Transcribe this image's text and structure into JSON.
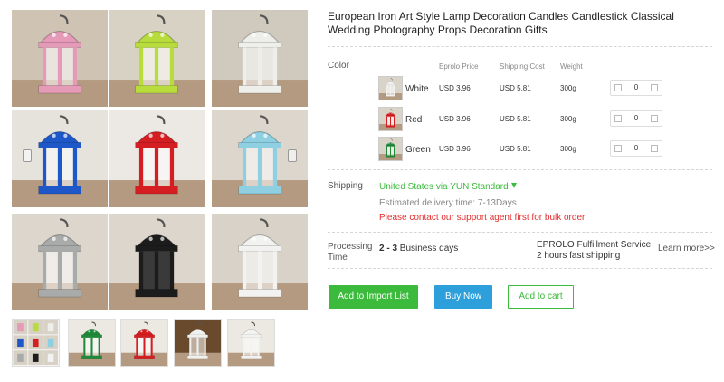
{
  "product": {
    "title": "European Iron Art Style Lamp Decoration Candles Candlestick Classical Wedding Photography Props Decoration Gifts"
  },
  "gallery": {
    "tiles": [
      {
        "name": "pink-lantern",
        "color": "#e59ab8",
        "bg": "#cfc3b4"
      },
      {
        "name": "lime-lantern",
        "color": "#b7dc3c",
        "bg": "#d8d2c4"
      },
      {
        "name": "white-lantern",
        "color": "#eeeeea",
        "bg": "#cfc9be"
      },
      {
        "name": "blue-lantern",
        "color": "#1e58c8",
        "bg": "#e6e2dc"
      },
      {
        "name": "red-lantern",
        "color": "#d41e22",
        "bg": "#ece9e4"
      },
      {
        "name": "lightblue-lantern",
        "color": "#8ed0e2",
        "bg": "#dcd6cc"
      },
      {
        "name": "silver-lantern",
        "color": "#a9abab",
        "bg": "#ddd6cc"
      },
      {
        "name": "black-lantern",
        "color": "#1c1c1c",
        "bg": "#ddd6cc"
      },
      {
        "name": "white-lantern-2",
        "color": "#f2f2f0",
        "bg": "#d8d2c8"
      }
    ],
    "thumbnails": [
      "collage",
      "green-lantern",
      "red-lantern",
      "white-lantern",
      "white-lantern"
    ]
  },
  "table": {
    "color_label": "Color",
    "headers": {
      "price": "Eprolo Price",
      "shipping": "Shipping Cost",
      "weight": "Weight"
    },
    "variants": [
      {
        "name": "White",
        "price": "USD 3.96",
        "shipping": "USD 5.81",
        "weight": "300g",
        "qty": "0",
        "swatch": "#f0f0ee"
      },
      {
        "name": "Red",
        "price": "USD 3.96",
        "shipping": "USD 5.81",
        "weight": "300g",
        "qty": "0",
        "swatch": "#d41e22"
      },
      {
        "name": "Green",
        "price": "USD 3.96",
        "shipping": "USD 5.81",
        "weight": "300g",
        "qty": "0",
        "swatch": "#1f8a3a"
      }
    ]
  },
  "shipping": {
    "label": "Shipping",
    "method": "United States via YUN Standard",
    "estimate": "Estimated delivery time: 7-13Days",
    "warning": "Please contact our support agent first for bulk order"
  },
  "processing": {
    "label": "Processing Time",
    "range": "2 - 3",
    "unit": "Business days",
    "service_line1": "EPROLO Fulfillment Service",
    "service_line2": "2 hours fast shipping",
    "learn_more": "Learn more>>"
  },
  "actions": {
    "import": "Add to Import List",
    "buy": "Buy Now",
    "cart": "Add to cart"
  },
  "colors": {
    "green": "#3cba3c",
    "blue": "#2d9fdb",
    "warning": "#e52d2d"
  }
}
